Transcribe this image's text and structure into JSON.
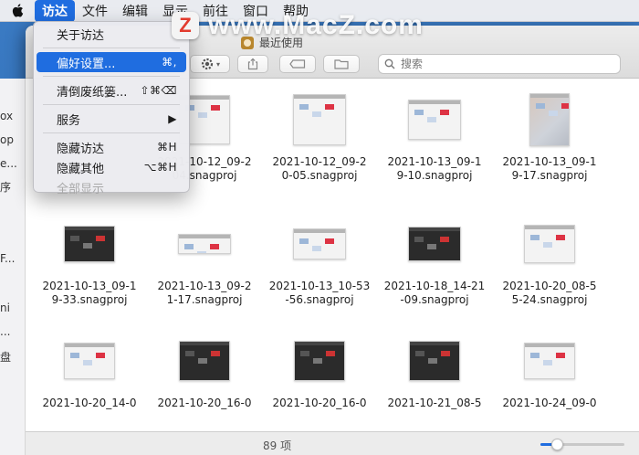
{
  "menubar": {
    "items": [
      "访达",
      "文件",
      "编辑",
      "显示",
      "前往",
      "窗口",
      "帮助"
    ],
    "active_index": 0
  },
  "watermark": {
    "badge": "Z",
    "text": "www.MacZ.com"
  },
  "app_menu": {
    "items": [
      {
        "label": "关于访达",
        "shortcut": ""
      },
      {
        "label": "偏好设置...",
        "shortcut": "⌘,",
        "highlighted": true
      },
      {
        "label": "清倒废纸篓...",
        "shortcut": "⇧⌘⌫"
      },
      {
        "label": "服务",
        "shortcut": "▶"
      },
      {
        "label": "隐藏访达",
        "shortcut": "⌘H"
      },
      {
        "label": "隐藏其他",
        "shortcut": "⌥⌘H"
      },
      {
        "label": "全部显示",
        "shortcut": "",
        "disabled": true
      }
    ]
  },
  "window": {
    "title": "最近使用",
    "search_placeholder": "搜索",
    "status": "89 项",
    "icon_size_fraction": 0.2
  },
  "sidebar_fragments": [
    "ox",
    "op",
    "e...",
    "序",
    "F...",
    "ni",
    "...",
    "盘"
  ],
  "files": [
    {
      "name": "2021-10-12_09-204.snagproj",
      "display": "2021-10-12_09-2\n04.snagproj",
      "thumb": "light"
    },
    {
      "name": "2021-10-12_09-20-05.snagproj",
      "display": "2021-10-12_09-2\n0-05.snagproj",
      "thumb": "light"
    },
    {
      "name": "2021-10-13_09-19-10.snagproj",
      "display": "2021-10-13_09-1\n9-10.snagproj",
      "thumb": "light"
    },
    {
      "name": "2021-10-13_09-19-17.snagproj",
      "display": "2021-10-13_09-1\n9-17.snagproj",
      "thumb": "photo"
    },
    {
      "name": "2021-10-13_09-19-33.snagproj",
      "display": "2021-10-13_09-1\n9-33.snagproj",
      "thumb": "dark"
    },
    {
      "name": "2021-10-13_09-21-17.snagproj",
      "display": "2021-10-13_09-2\n1-17.snagproj",
      "thumb": "light"
    },
    {
      "name": "2021-10-13_10-53-56.snagproj",
      "display": "2021-10-13_10-53\n-56.snagproj",
      "thumb": "light"
    },
    {
      "name": "2021-10-18_14-21-09.snagproj",
      "display": "2021-10-18_14-21\n-09.snagproj",
      "thumb": "dark"
    },
    {
      "name": "2021-10-20_08-55-24.snagproj",
      "display": "2021-10-20_08-5\n5-24.snagproj",
      "thumb": "light"
    },
    {
      "name": "2021-10-20_14-0",
      "display": "2021-10-20_14-0",
      "thumb": "light"
    },
    {
      "name": "2021-10-20_16-0",
      "display": "2021-10-20_16-0",
      "thumb": "dark"
    },
    {
      "name": "2021-10-20_16-0",
      "display": "2021-10-20_16-0",
      "thumb": "dark"
    },
    {
      "name": "2021-10-21_08-5",
      "display": "2021-10-21_08-5",
      "thumb": "dark"
    },
    {
      "name": "2021-10-24_09-0",
      "display": "2021-10-24_09-0",
      "thumb": "light"
    }
  ]
}
